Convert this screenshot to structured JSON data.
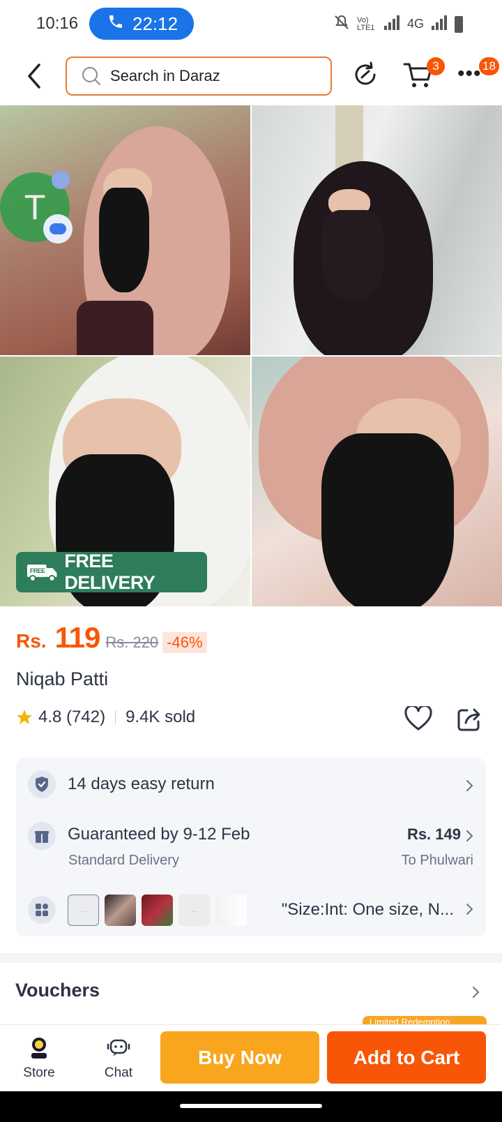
{
  "status_bar": {
    "time": "10:16",
    "call_timer": "22:12",
    "network_label": "4G",
    "volte_label": "Vo) LTE1"
  },
  "nav": {
    "search_placeholder": "Search in Daraz",
    "cart_count": "3",
    "more_count": "18"
  },
  "gallery": {
    "badge_free": "FREE",
    "badge_label": "FREE DELIVERY",
    "floating_bubble_letter": "T"
  },
  "product": {
    "price_prefix": "Rs.",
    "price_value": "119",
    "price_old": "Rs. 220",
    "discount": "-46%",
    "title": "Niqab Patti",
    "rating": "4.8 (742)",
    "sold": "9.4K sold"
  },
  "info": {
    "return_text": "14 days easy return",
    "delivery_text": "Guaranteed by 9-12 Feb",
    "delivery_type": "Standard Delivery",
    "delivery_price": "Rs. 149",
    "delivery_destination": "To Phulwari",
    "variant_text": "\"Size:Int: One size, N...",
    "thumb_placeholder": "..."
  },
  "vouchers": {
    "title": "Vouchers",
    "tag": "Limited Redemption"
  },
  "bottom": {
    "store_label": "Store",
    "chat_label": "Chat",
    "buy_now": "Buy Now",
    "add_to_cart": "Add to Cart"
  },
  "colors": {
    "brand_orange": "#f85606",
    "buy_now_yellow": "#f9a51d",
    "free_delivery_green": "#2e7d5b",
    "call_pill_blue": "#1a73e8"
  }
}
